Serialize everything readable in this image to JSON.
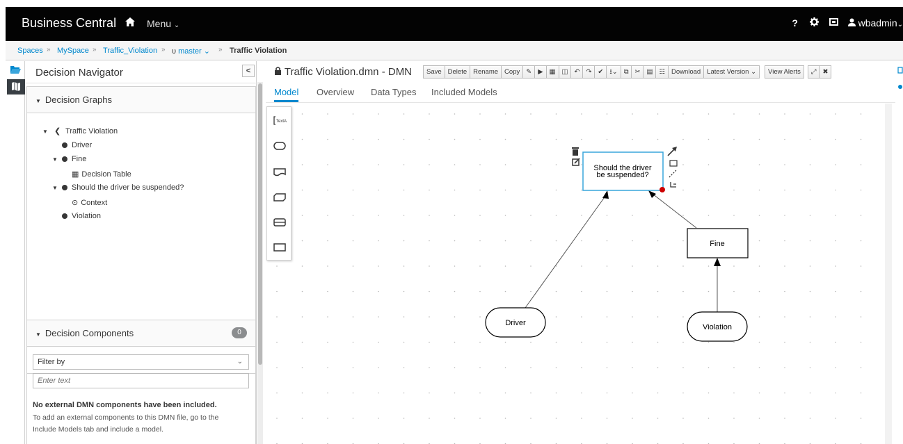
{
  "app": {
    "brand": "Business Central",
    "menu_label": "Menu",
    "help_label": "?",
    "user_label": "wbadmin"
  },
  "breadcrumb": {
    "items": [
      "Spaces",
      "MySpace",
      "Traffic_Violation",
      "master"
    ],
    "separator": "»",
    "current": "Traffic Violation"
  },
  "navigator": {
    "title": "Decision Navigator",
    "collapse_label": "<",
    "graphs_title": "Decision Graphs",
    "tree": [
      {
        "label": "Traffic Violation"
      },
      {
        "label": "Driver"
      },
      {
        "label": "Fine"
      },
      {
        "label": "Decision Table"
      },
      {
        "label": "Should the driver be suspended?"
      },
      {
        "label": "Context"
      },
      {
        "label": "Violation"
      }
    ],
    "components_title": "Decision Components",
    "components_count": "0",
    "filter_label": "Filter by",
    "filter_placeholder": "Enter text",
    "empty_title": "No external DMN components have been included.",
    "empty_help": "To add an external components to this DMN file, go to the Include Models tab and include a model."
  },
  "editor": {
    "title": "Traffic Violation.dmn - DMN",
    "toolbar": {
      "save": "Save",
      "delete": "Delete",
      "rename": "Rename",
      "copy": "Copy",
      "download": "Download",
      "latest_version": "Latest Version",
      "view_alerts": "View Alerts"
    },
    "tabs": [
      "Model",
      "Overview",
      "Data Types",
      "Included Models"
    ],
    "active_tab": "Model"
  },
  "diagram": {
    "nodes": {
      "decision_main_line1": "Should the driver",
      "decision_main_line2": "be suspended?",
      "fine": "Fine",
      "driver": "Driver",
      "violation": "Violation"
    }
  },
  "colors": {
    "accent": "#0088ce",
    "topbar": "#030303",
    "selected_node_border": "#39a5dc",
    "connector_dot": "#cc0000"
  }
}
